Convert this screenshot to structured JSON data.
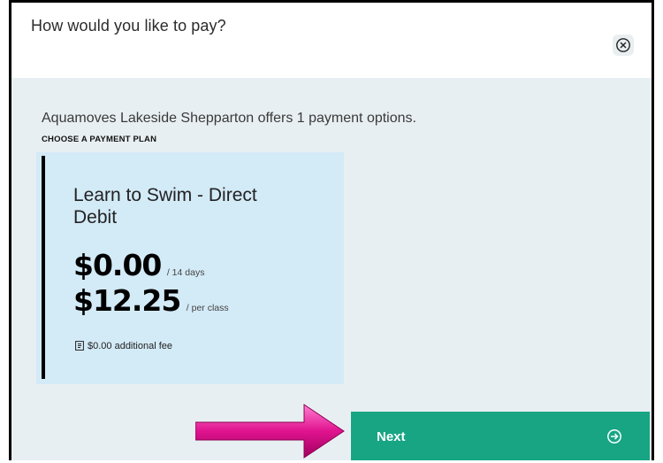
{
  "dialog": {
    "title": "How would you like to pay?",
    "close_icon": "close-circle-icon"
  },
  "content": {
    "intro": "Aquamoves Lakeside Shepparton offers 1 payment options.",
    "choose_label": "CHOOSE A PAYMENT PLAN"
  },
  "plan": {
    "name": "Learn to Swim - Direct Debit",
    "price_1": "$0.00",
    "period_1": "/ 14 days",
    "price_2": "$12.25",
    "period_2": "/  per class",
    "fee": "$0.00 additional fee",
    "fee_icon": "receipt-icon",
    "accent_color": "#d3eaf7"
  },
  "footer": {
    "next_label": "Next",
    "next_icon": "arrow-right-circle-icon",
    "next_color": "#17a584",
    "pointer_icon": "pink-arrow-icon"
  }
}
